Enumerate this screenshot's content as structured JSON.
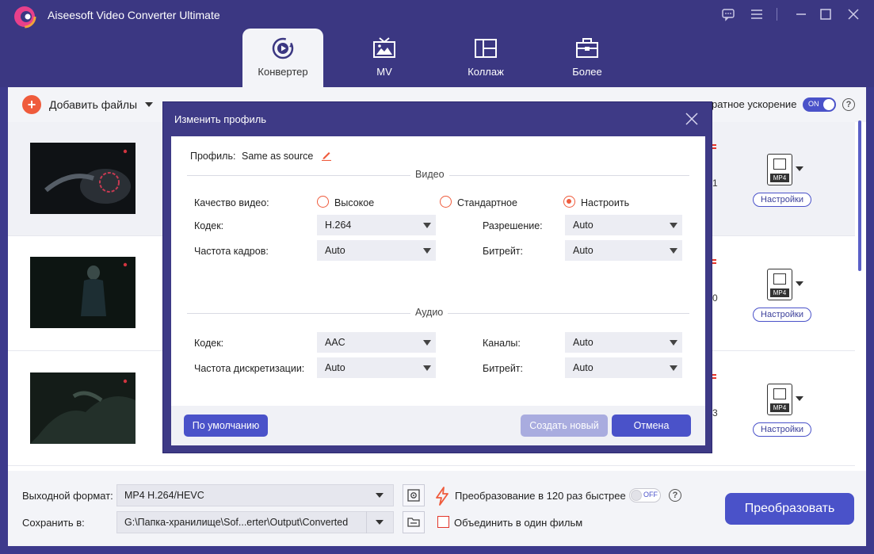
{
  "app": {
    "title": "Aiseesoft Video Converter Ultimate"
  },
  "tabs": [
    {
      "label": "Конвертер",
      "icon": "converter-icon"
    },
    {
      "label": "MV",
      "icon": "mv-icon"
    },
    {
      "label": "Коллаж",
      "icon": "collage-icon"
    },
    {
      "label": "Более",
      "icon": "toolbox-icon"
    }
  ],
  "toolbar": {
    "add_files_label": "Добавить файлы",
    "hw_accel_label": "ратное ускорение",
    "hw_toggle_label": "ON"
  },
  "file_rows": [
    {
      "format_badge": "MP4",
      "settings_label": "Настройки",
      "digit": "1"
    },
    {
      "format_badge": "MP4",
      "settings_label": "Настройки",
      "digit": "0"
    },
    {
      "format_badge": "MP4",
      "settings_label": "Настройки",
      "digit": "3"
    }
  ],
  "dialog": {
    "title": "Изменить профиль",
    "profile_label": "Профиль:",
    "profile_value": "Same as source",
    "video_section": "Видео",
    "audio_section": "Аудио",
    "video_quality_label": "Качество видео:",
    "quality_options": [
      "Высокое",
      "Стандартное",
      "Настроить"
    ],
    "quality_selected": "Настроить",
    "video_codec_label": "Кодек:",
    "video_codec_value": "H.264",
    "resolution_label": "Разрешение:",
    "resolution_value": "Auto",
    "framerate_label": "Частота кадров:",
    "framerate_value": "Auto",
    "video_bitrate_label": "Битрейт:",
    "video_bitrate_value": "Auto",
    "audio_codec_label": "Кодек:",
    "audio_codec_value": "AAC",
    "channels_label": "Каналы:",
    "channels_value": "Auto",
    "samplerate_label": "Частота дискретизации:",
    "samplerate_value": "Auto",
    "audio_bitrate_label": "Битрейт:",
    "audio_bitrate_value": "Auto",
    "default_button": "По умолчанию",
    "create_button": "Создать новый",
    "cancel_button": "Отмена"
  },
  "bottom": {
    "output_format_label": "Выходной формат:",
    "output_format_value": "MP4 H.264/HEVC",
    "save_to_label": "Сохранить в:",
    "save_to_value": "G:\\Папка-хранилище\\Sof...erter\\Output\\Converted",
    "speed_label": "Преобразование в 120 раз быстрее",
    "speed_toggle_label": "OFF",
    "merge_label": "Объединить в один фильм",
    "convert_button": "Преобразовать"
  },
  "colors": {
    "brand": "#3b3782",
    "accent": "#4a52c9",
    "orange": "#ef5b3c"
  }
}
